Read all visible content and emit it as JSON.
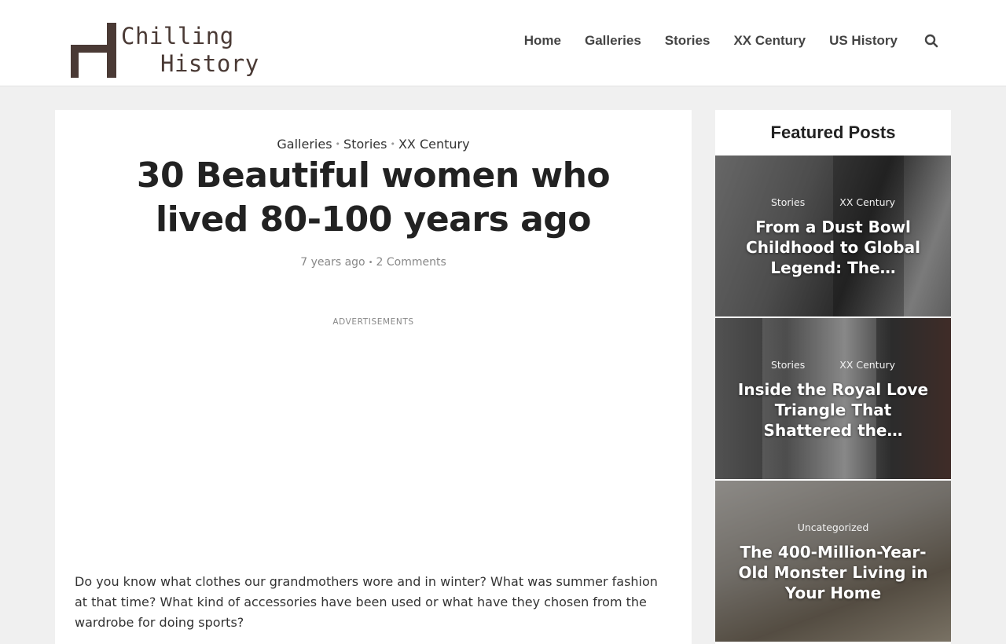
{
  "logo": {
    "line1": "Chilling",
    "line2": "History"
  },
  "nav": {
    "items": [
      "Home",
      "Galleries",
      "Stories",
      "XX Century",
      "US History"
    ],
    "search_icon": "search-icon"
  },
  "article": {
    "categories": [
      "Galleries",
      "Stories",
      "XX Century"
    ],
    "title": "30 Beautiful women who lived 80-100 years ago",
    "meta_time": "7 years ago",
    "meta_comments": "2 Comments",
    "ads_label": "ADVERTISEMENTS",
    "body": "Do you know what clothes our grandmothers wore and in winter? What was summer fashion at that time? What kind of accessories have been used or what have they chosen from the wardrobe for doing sports?"
  },
  "sidebar": {
    "title": "Featured Posts",
    "posts": [
      {
        "cat1": "Stories",
        "cat2": "XX Century",
        "title": "From a Dust Bowl Childhood to Global Legend: The…"
      },
      {
        "cat1": "Stories",
        "cat2": "XX Century",
        "title": "Inside the Royal Love Triangle That Shattered the…"
      },
      {
        "cat1": "Uncategorized",
        "cat2": "",
        "title": "The 400-Million-Year-Old Monster Living in Your Home"
      }
    ]
  },
  "colors": {
    "logo_brown": "#4a3a35",
    "nav_text": "#444444"
  }
}
